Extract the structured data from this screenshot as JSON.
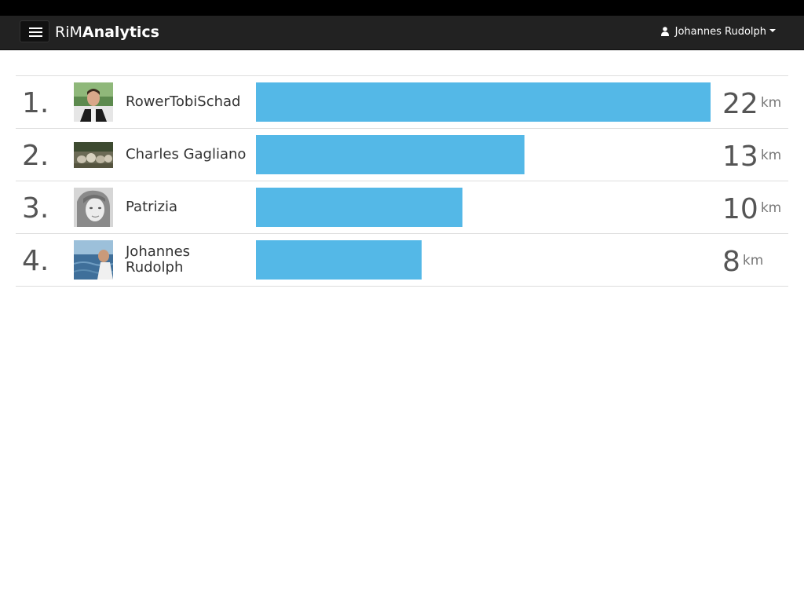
{
  "navbar": {
    "brand_light": "RiM",
    "brand_bold": "Analytics",
    "user_name": "Johannes Rudolph",
    "bg_color": "#222222"
  },
  "leaderboard": {
    "bar_color": "#54b8e7",
    "max_distance": 22,
    "entries": [
      {
        "rank": "1.",
        "name": "RowerTobiSchad",
        "distance": 22,
        "distance_label": "22",
        "unit": "km"
      },
      {
        "rank": "2.",
        "name": "Charles Gagliano",
        "distance": 13,
        "distance_label": "13",
        "unit": "km"
      },
      {
        "rank": "3.",
        "name": "Patrizia",
        "distance": 10,
        "distance_label": "10",
        "unit": "km"
      },
      {
        "rank": "4.",
        "name": "Johannes Rudolph",
        "distance": 8,
        "distance_label": "8",
        "unit": "km"
      }
    ]
  }
}
